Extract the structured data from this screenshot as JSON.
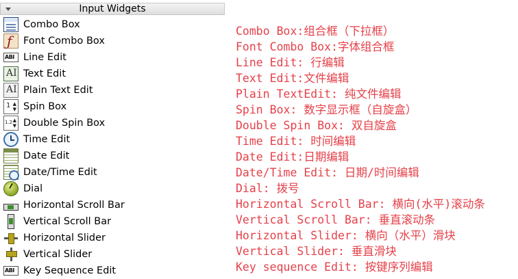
{
  "widget_box": {
    "section_title": "Input Widgets",
    "items": [
      {
        "label": "Combo Box",
        "icon": "combo-box-icon"
      },
      {
        "label": "Font Combo Box",
        "icon": "font-combo-box-icon"
      },
      {
        "label": "Line Edit",
        "icon": "line-edit-icon",
        "icon_text": "ABI"
      },
      {
        "label": "Text Edit",
        "icon": "text-edit-icon",
        "icon_text": "AI"
      },
      {
        "label": "Plain Text Edit",
        "icon": "plain-text-edit-icon",
        "icon_text": "AI"
      },
      {
        "label": "Spin Box",
        "icon": "spin-box-icon",
        "icon_text": "1"
      },
      {
        "label": "Double Spin Box",
        "icon": "double-spin-box-icon",
        "icon_text": "1.2"
      },
      {
        "label": "Time Edit",
        "icon": "clock-icon"
      },
      {
        "label": "Date Edit",
        "icon": "calendar-icon"
      },
      {
        "label": "Date/Time Edit",
        "icon": "calendar-clock-icon"
      },
      {
        "label": "Dial",
        "icon": "dial-icon"
      },
      {
        "label": "Horizontal Scroll Bar",
        "icon": "horizontal-scroll-bar-icon"
      },
      {
        "label": "Vertical Scroll Bar",
        "icon": "vertical-scroll-bar-icon"
      },
      {
        "label": "Horizontal Slider",
        "icon": "horizontal-slider-icon"
      },
      {
        "label": "Vertical Slider",
        "icon": "vertical-slider-icon"
      },
      {
        "label": "Key Sequence Edit",
        "icon": "key-sequence-edit-icon",
        "icon_text": "ABI"
      }
    ]
  },
  "annotations": [
    "Combo Box:组合框（下拉框）",
    "Font Combo Box:字体组合框",
    "Line Edit: 行编辑",
    "Text Edit:文件编辑",
    "Plain TextEdit: 纯文件编辑",
    "Spin Box: 数字显示框（自旋盒）",
    "Double Spin Box: 双自旋盒",
    "Time Edit: 时间编辑",
    "Date Edit:日期编辑",
    "Date/Time Edit: 日期/时间编辑",
    "Dial: 拨号",
    "Horizontal Scroll Bar: 横向(水平)滚动条",
    "Vertical Scroll Bar: 垂直滚动条",
    "Horizontal Slider: 横向（水平）滑块",
    "Vertical Slider: 垂直滑块",
    "Key sequence Edit: 按键序列编辑"
  ],
  "colors": {
    "annotation_text": "#e5414a",
    "header_background": "#e6e6e6"
  }
}
